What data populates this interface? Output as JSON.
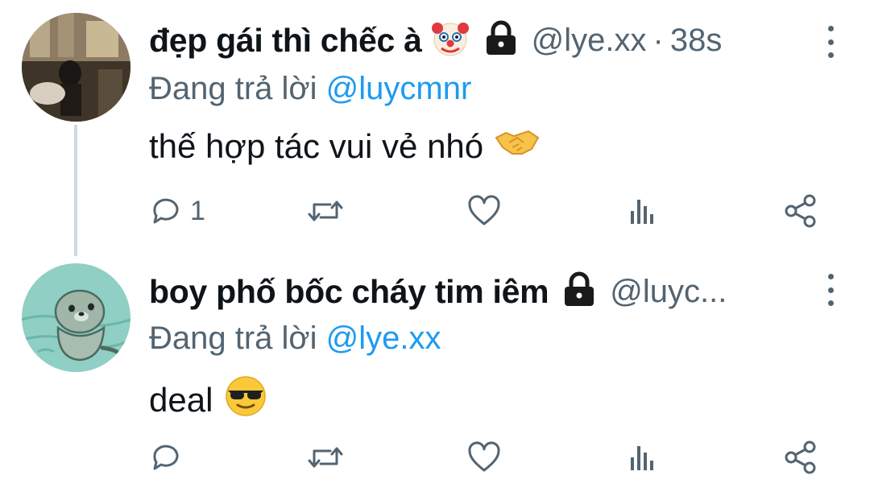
{
  "tweets": [
    {
      "display_name": "đẹp gái thì chếc à",
      "name_emoji": "🤡",
      "lock_icon": "lock-icon",
      "handle": "@lye.xx",
      "separator": "·",
      "time": "38s",
      "reply_prefix": "Đang trả lời",
      "reply_to": "@luycmnr",
      "text": "thế hợp tác vui vẻ nhó",
      "text_emoji": "🤝",
      "reply_count": "1"
    },
    {
      "display_name": "boy phố bốc cháy tim iêm",
      "lock_icon": "lock-icon",
      "handle": "@luyc...",
      "reply_prefix": "Đang trả lời",
      "reply_to": "@lye.xx",
      "text": "deal",
      "text_emoji": "😎",
      "reply_count": ""
    }
  ],
  "colors": {
    "name": "#0f1419",
    "secondary": "#536471",
    "mention": "#1d9bf0",
    "thread_line": "#cfd9de"
  }
}
